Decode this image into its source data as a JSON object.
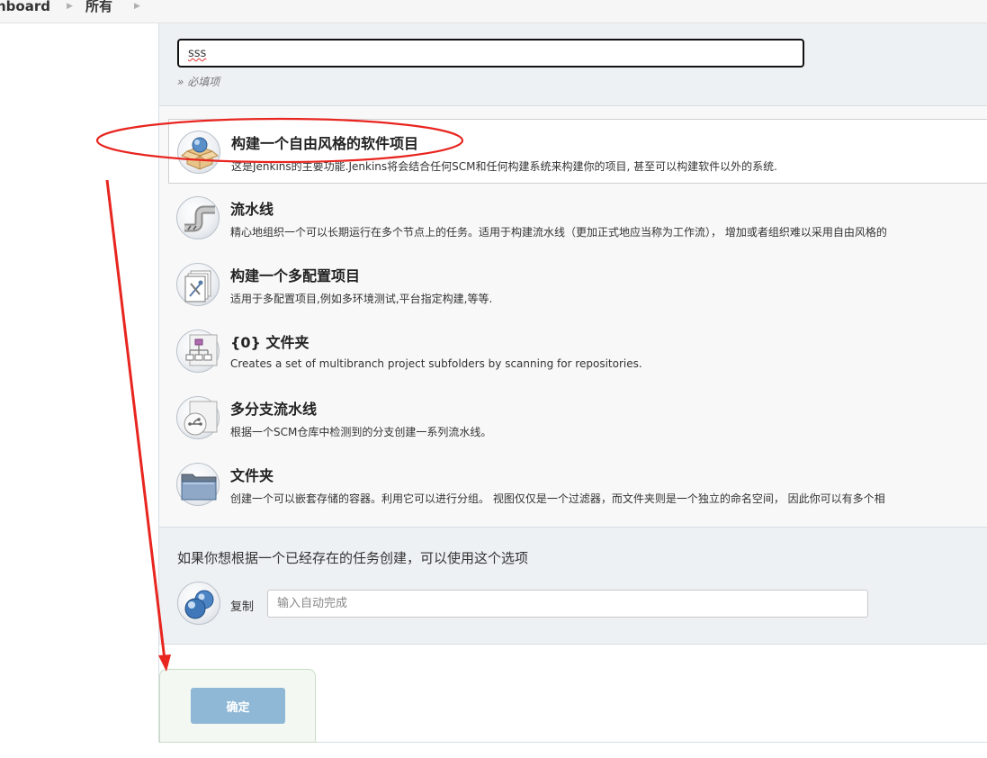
{
  "breadcrumb": {
    "items": [
      "hboard",
      "所有"
    ]
  },
  "name_field": {
    "value": "sss",
    "required_hint": "» 必填项"
  },
  "item_types": [
    {
      "title": "构建一个自由风格的软件项目",
      "description": "这是Jenkins的主要功能.Jenkins将会结合任何SCM和任何构建系统来构建你的项目, 甚至可以构建软件以外的系统.",
      "icon": "freestyle-box-icon",
      "selected": true
    },
    {
      "title": "流水线",
      "description": "精心地组织一个可以长期运行在多个节点上的任务。适用于构建流水线（更加正式地应当称为工作流）， 增加或者组织难以采用自由风格的",
      "icon": "pipeline-icon",
      "selected": false
    },
    {
      "title": "构建一个多配置项目",
      "description": "适用于多配置项目,例如多环境测试,平台指定构建,等等.",
      "icon": "multi-config-icon",
      "selected": false
    },
    {
      "title": "{0} 文件夹",
      "description": "Creates a set of multibranch project subfolders by scanning for repositories.",
      "icon": "org-folder-icon",
      "selected": false
    },
    {
      "title": "多分支流水线",
      "description": "根据一个SCM仓库中检测到的分支创建一系列流水线。",
      "icon": "multibranch-icon",
      "selected": false
    },
    {
      "title": "文件夹",
      "description": "创建一个可以嵌套存储的容器。利用它可以进行分组。 视图仅仅是一个过滤器，而文件夹则是一个独立的命名空间， 因此你可以有多个相",
      "icon": "folder-icon",
      "selected": false
    }
  ],
  "copy_section": {
    "label": "如果你想根据一个已经存在的任务创建，可以使用这个选项",
    "field_label": "复制",
    "placeholder": "输入自动完成"
  },
  "ok_button": {
    "label": "确定"
  },
  "colors": {
    "ok_button": "#8eb8d6",
    "annotation": "#e8251f"
  }
}
